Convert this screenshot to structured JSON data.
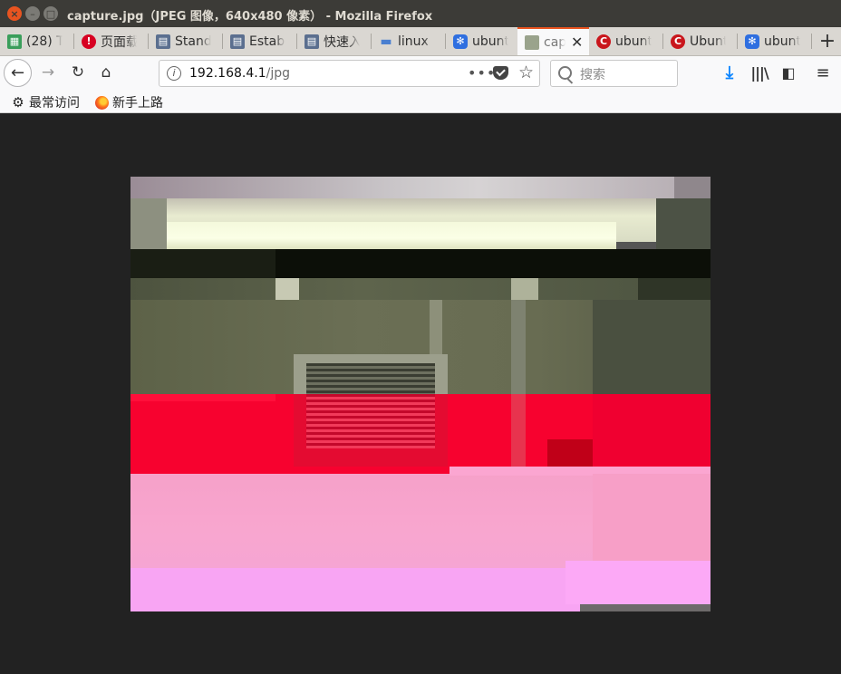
{
  "window": {
    "title": "capture.jpg（JPEG 图像，640x480 像素） - Mozilla Firefox",
    "close_glyph": "×",
    "min_glyph": "–",
    "max_glyph": "□"
  },
  "tabs": [
    {
      "label": "(28) Ta",
      "icon": "tasks-icon",
      "color": "#3a9e5b"
    },
    {
      "label": "页面载",
      "icon": "error-icon",
      "color": "#d70022"
    },
    {
      "label": "Stand",
      "icon": "page-icon",
      "color": "#5b6f8f"
    },
    {
      "label": "Estab",
      "icon": "page-icon",
      "color": "#5b6f8f"
    },
    {
      "label": "快速入",
      "icon": "page-icon",
      "color": "#5b6f8f"
    },
    {
      "label": "linux",
      "icon": "dash-icon",
      "color": "#4a7fd0"
    },
    {
      "label": "ubunt",
      "icon": "baidu-paw-icon",
      "color": "#2f6fe0"
    },
    {
      "label": "cap",
      "icon": "image-thumb-icon",
      "color": "#9aa38c",
      "active": true
    },
    {
      "label": "ubunt",
      "icon": "csdn-icon",
      "color": "#c9161c"
    },
    {
      "label": "Ubunt",
      "icon": "csdn-icon",
      "color": "#c9161c"
    },
    {
      "label": "ubunt",
      "icon": "baidu-paw-icon",
      "color": "#2f6fe0"
    }
  ],
  "nav": {
    "url_host": "192.168.4.1",
    "url_path": "/jpg",
    "search_placeholder": "搜索"
  },
  "bookmarks": [
    {
      "label": "最常访问",
      "icon": "gear-icon"
    },
    {
      "label": "新手上路",
      "icon": "firefox-icon"
    }
  ],
  "image": {
    "description_alt": "capture.jpg"
  }
}
